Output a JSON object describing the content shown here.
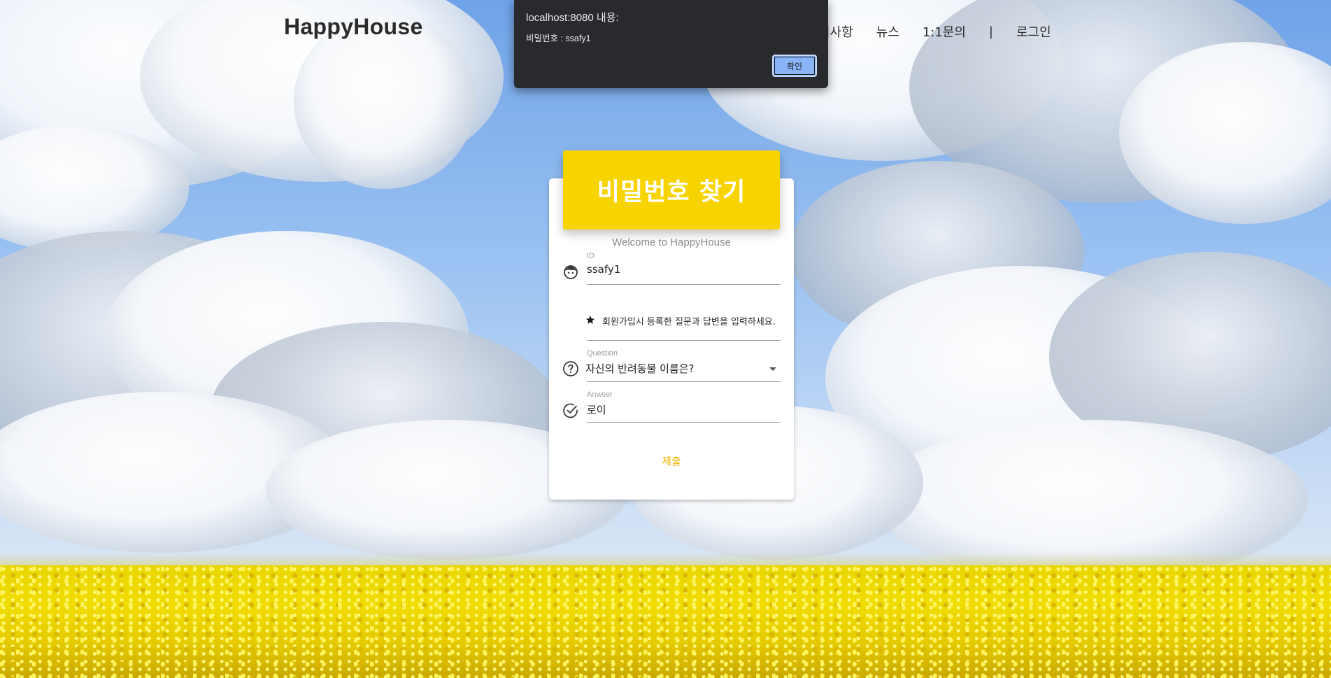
{
  "header": {
    "logo": "HappyHouse",
    "nav": [
      "지사항",
      "뉴스",
      "1:1문의",
      "|",
      "로그인"
    ]
  },
  "alert": {
    "title": "localhost:8080 내용:",
    "message": "비밀번호 : ssafy1",
    "ok_label": "확인"
  },
  "card": {
    "title": "비밀번호 찾기",
    "subtitle": "Welcome to HappyHouse",
    "id_label": "ID",
    "id_value": "ssafy1",
    "hint": "회원가입시 등록한 질문과 답변을 입력하세요.",
    "question_label": "Question",
    "question_value": "자신의 반려동물 이름은?",
    "answer_label": "Anwser",
    "answer_value": "로이",
    "submit_label": "제출"
  },
  "colors": {
    "accent": "#f7d300",
    "submit_text": "#f2b400",
    "alert_bg": "#292a2d",
    "alert_button": "#8ab4f8"
  },
  "icons": [
    "face-icon",
    "star-icon",
    "help-circle-icon",
    "check-circle-icon",
    "dropdown-caret-icon"
  ]
}
